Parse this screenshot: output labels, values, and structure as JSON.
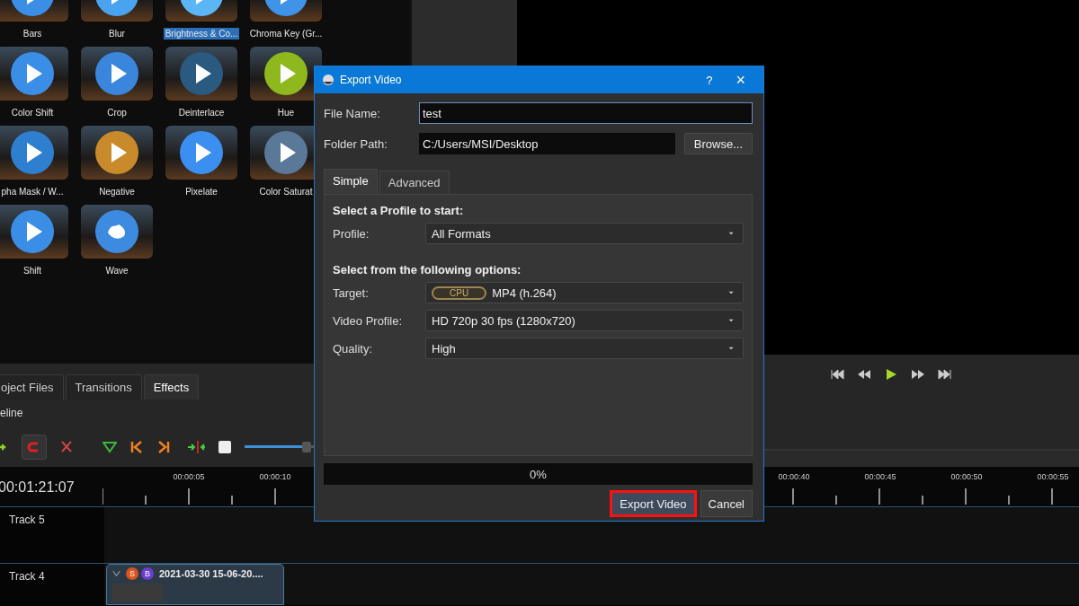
{
  "effects": [
    {
      "label": "Bars",
      "selected": false,
      "color": "#3a8ee6",
      "kind": "play"
    },
    {
      "label": "Blur",
      "selected": false,
      "color": "#4aa3ef",
      "kind": "play"
    },
    {
      "label": "Brightness & Co...",
      "selected": true,
      "color": "#5ab6f5",
      "kind": "play"
    },
    {
      "label": "Chroma Key (Gr...",
      "selected": false,
      "color": "#3f93e8",
      "kind": "play"
    },
    {
      "label": "Color Shift",
      "selected": false,
      "color": "#3a8ee6",
      "kind": "play"
    },
    {
      "label": "Crop",
      "selected": false,
      "color": "#3a86dc",
      "kind": "play"
    },
    {
      "label": "Deinterlace",
      "selected": false,
      "color": "#2a5a80",
      "kind": "play"
    },
    {
      "label": "Hue",
      "selected": false,
      "color": "#8fb81f",
      "kind": "play"
    },
    {
      "label": "pha Mask / W...",
      "selected": false,
      "color": "#2f7fd0",
      "kind": "play"
    },
    {
      "label": "Negative",
      "selected": false,
      "color": "#c98a2c",
      "kind": "play"
    },
    {
      "label": "Pixelate",
      "selected": false,
      "color": "#3b8ff0",
      "kind": "play"
    },
    {
      "label": "Color Saturat",
      "selected": false,
      "color": "#5a7898",
      "kind": "play"
    },
    {
      "label": "Shift",
      "selected": false,
      "color": "#3a8ee6",
      "kind": "play"
    },
    {
      "label": "Wave",
      "selected": false,
      "color": "#3d8be0",
      "kind": "wave"
    }
  ],
  "panel_tabs": [
    {
      "label": "oject Files",
      "selected": false
    },
    {
      "label": "Transitions",
      "selected": false
    },
    {
      "label": "Effects",
      "selected": true
    }
  ],
  "timeline": {
    "title": "eline",
    "snapping_on": true,
    "zoom": {
      "level": 0.92
    },
    "timecode": "00:01:21:07",
    "ruler": {
      "labels_left": [
        "00:00:05",
        "00:00:10"
      ],
      "labels_right": [
        "00:00:40",
        "00:00:45",
        "00:00:50",
        "00:00:55"
      ]
    },
    "tracks": [
      {
        "name": "Track 5"
      },
      {
        "name": "Track 4",
        "clips": [
          {
            "title": "2021-03-30 15-06-20....",
            "badges": [
              {
                "letter": "S",
                "color": "#d9531e"
              },
              {
                "letter": "B",
                "color": "#6a3fd0"
              }
            ]
          }
        ]
      }
    ]
  },
  "dialog": {
    "title": "Export Video",
    "help": "?",
    "close": "×",
    "file_name_label": "File Name:",
    "file_name": "test",
    "folder_label": "Folder Path:",
    "folder": "C:/Users/MSI/Desktop",
    "browse": "Browse...",
    "tabs": [
      {
        "label": "Simple",
        "selected": true
      },
      {
        "label": "Advanced",
        "selected": false
      }
    ],
    "profile_heading": "Select a Profile to start:",
    "profile": {
      "label": "Profile:",
      "value": "All Formats"
    },
    "options_heading": "Select from the following options:",
    "options": [
      {
        "label": "Target:",
        "value": "MP4 (h.264)",
        "badge": "CPU"
      },
      {
        "label": "Video Profile:",
        "value": "HD 720p 30 fps (1280x720)"
      },
      {
        "label": "Quality:",
        "value": "High"
      }
    ],
    "progress": {
      "level": 0,
      "reading": "0%"
    },
    "buttons": [
      {
        "label": "Export Video",
        "highlighted": true
      },
      {
        "label": "Cancel",
        "highlighted": false
      }
    ]
  }
}
